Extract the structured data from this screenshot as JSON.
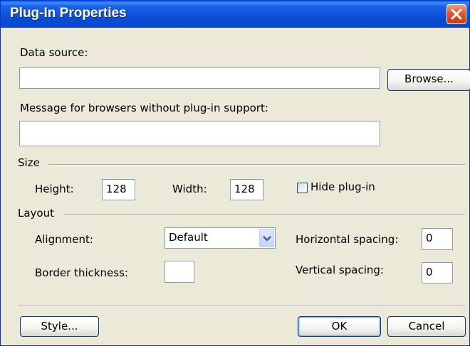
{
  "window": {
    "title": "Plug-In Properties",
    "close_icon": "close-icon"
  },
  "data_source": {
    "label": "Data source:",
    "value": "",
    "browse_label": "Browse..."
  },
  "message": {
    "label": "Message for browsers without plug-in support:",
    "value": ""
  },
  "size": {
    "section_label": "Size",
    "height_label": "Height:",
    "height_value": "128",
    "width_label": "Width:",
    "width_value": "128",
    "hide_label": "Hide plug-in",
    "hide_checked": false
  },
  "layout": {
    "section_label": "Layout",
    "alignment_label": "Alignment:",
    "alignment_value": "Default",
    "border_label": "Border thickness:",
    "border_value": "",
    "hspacing_label": "Horizontal spacing:",
    "hspacing_value": "0",
    "vspacing_label": "Vertical spacing:",
    "vspacing_value": "0"
  },
  "footer": {
    "style_label": "Style...",
    "ok_label": "OK",
    "cancel_label": "Cancel"
  },
  "colors": {
    "titlebar": "#0a4fd8",
    "close": "#e45a2c",
    "dialog_bg": "#ece9d8"
  }
}
